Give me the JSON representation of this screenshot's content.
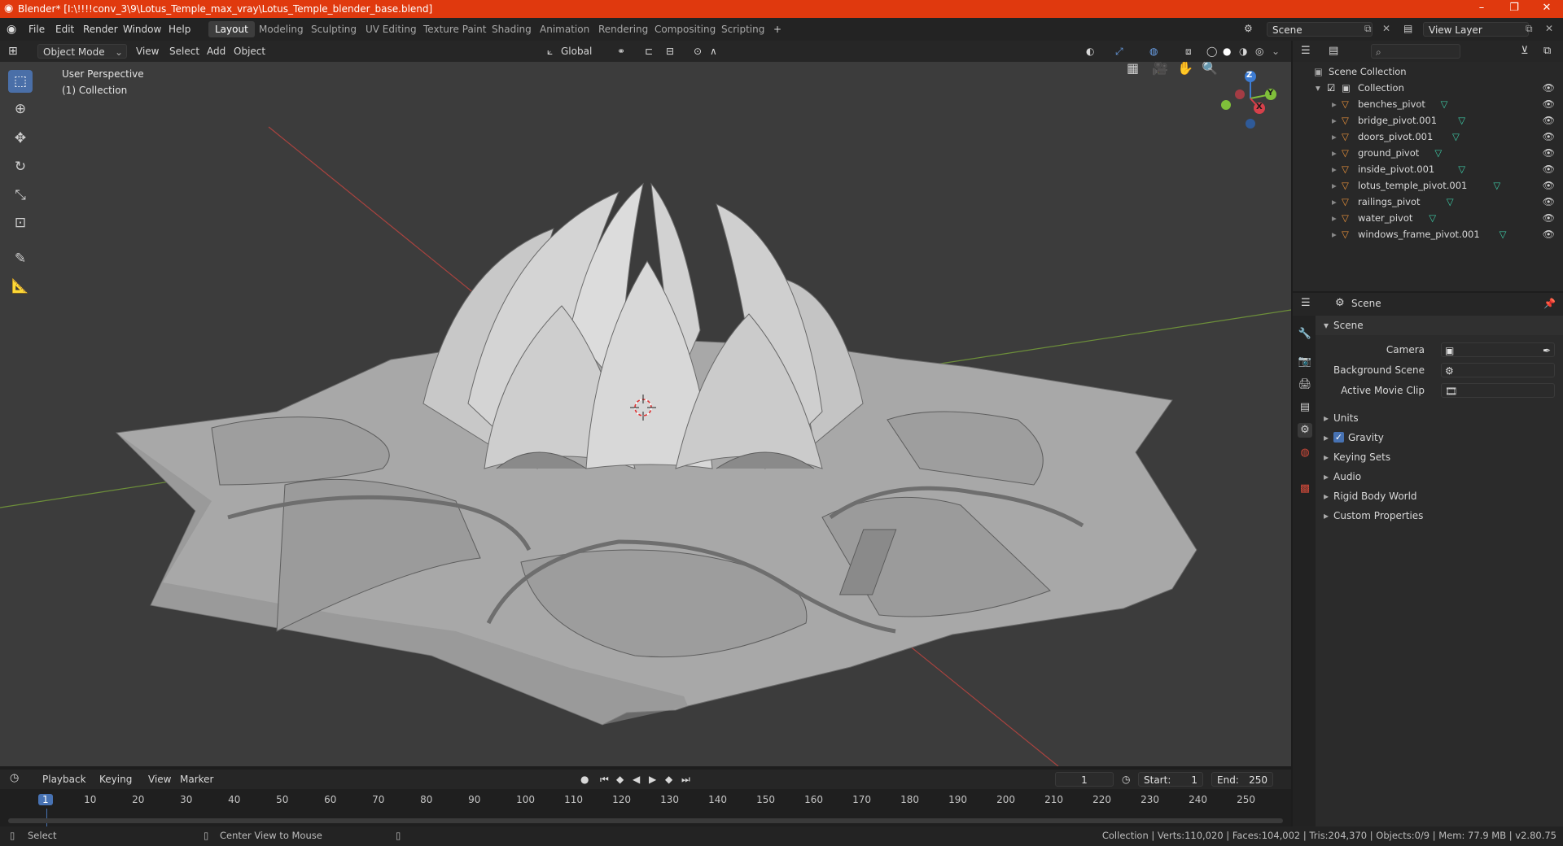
{
  "window": {
    "title": "Blender* [I:\\!!!!conv_3\\9\\Lotus_Temple_max_vray\\Lotus_Temple_blender_base.blend]",
    "minimize": "–",
    "maximize": "❐",
    "close": "✕"
  },
  "menu": [
    "File",
    "Edit",
    "Render",
    "Window",
    "Help"
  ],
  "workspaces": [
    "Layout",
    "Modeling",
    "Sculpting",
    "UV Editing",
    "Texture Paint",
    "Shading",
    "Animation",
    "Rendering",
    "Compositing",
    "Scripting"
  ],
  "workspace_add": "+",
  "scene_field": "Scene",
  "view_layer_field": "View Layer",
  "viewport": {
    "mode": "Object Mode",
    "menus": [
      "View",
      "Select",
      "Add",
      "Object"
    ],
    "transform_orientation": "Global",
    "info_line1": "User Perspective",
    "info_line2": "(1) Collection",
    "gizmo": {
      "z": "Z",
      "y": "Y",
      "x": "X"
    }
  },
  "timeline": {
    "menus": [
      "Playback",
      "Keying",
      "View",
      "Marker"
    ],
    "current_frame": "1",
    "start_label": "Start:",
    "start": "1",
    "end_label": "End:",
    "end": "250",
    "ticks": [
      "1",
      "10",
      "20",
      "30",
      "40",
      "50",
      "60",
      "70",
      "80",
      "90",
      "100",
      "110",
      "120",
      "130",
      "140",
      "150",
      "160",
      "170",
      "180",
      "190",
      "200",
      "210",
      "220",
      "230",
      "240",
      "250"
    ]
  },
  "status": {
    "left": "Select",
    "middle": "Center View to Mouse",
    "right": "Collection | Verts:110,020 | Faces:104,002 | Tris:204,370 | Objects:0/9 | Mem: 77.9 MB | v2.80.75"
  },
  "outliner": {
    "root": "Scene Collection",
    "collection": "Collection",
    "items": [
      "benches_pivot",
      "bridge_pivot.001",
      "doors_pivot.001",
      "ground_pivot",
      "inside_pivot.001",
      "lotus_temple_pivot.001",
      "railings_pivot",
      "water_pivot",
      "windows_frame_pivot.001"
    ]
  },
  "properties": {
    "header": "Scene",
    "panel": "Scene",
    "camera_label": "Camera",
    "background_scene_label": "Background Scene",
    "active_movie_clip_label": "Active Movie Clip",
    "sections": [
      "Units",
      "Gravity",
      "Keying Sets",
      "Audio",
      "Rigid Body World",
      "Custom Properties"
    ]
  },
  "colors": {
    "titlebar": "#e0390e",
    "viewport_bg": "#3c3c3c",
    "active_blue": "#4a6fa8",
    "playhead": "#4772b3",
    "object_orange": "#e8913a",
    "mesh_green": "#3ec9a5"
  }
}
